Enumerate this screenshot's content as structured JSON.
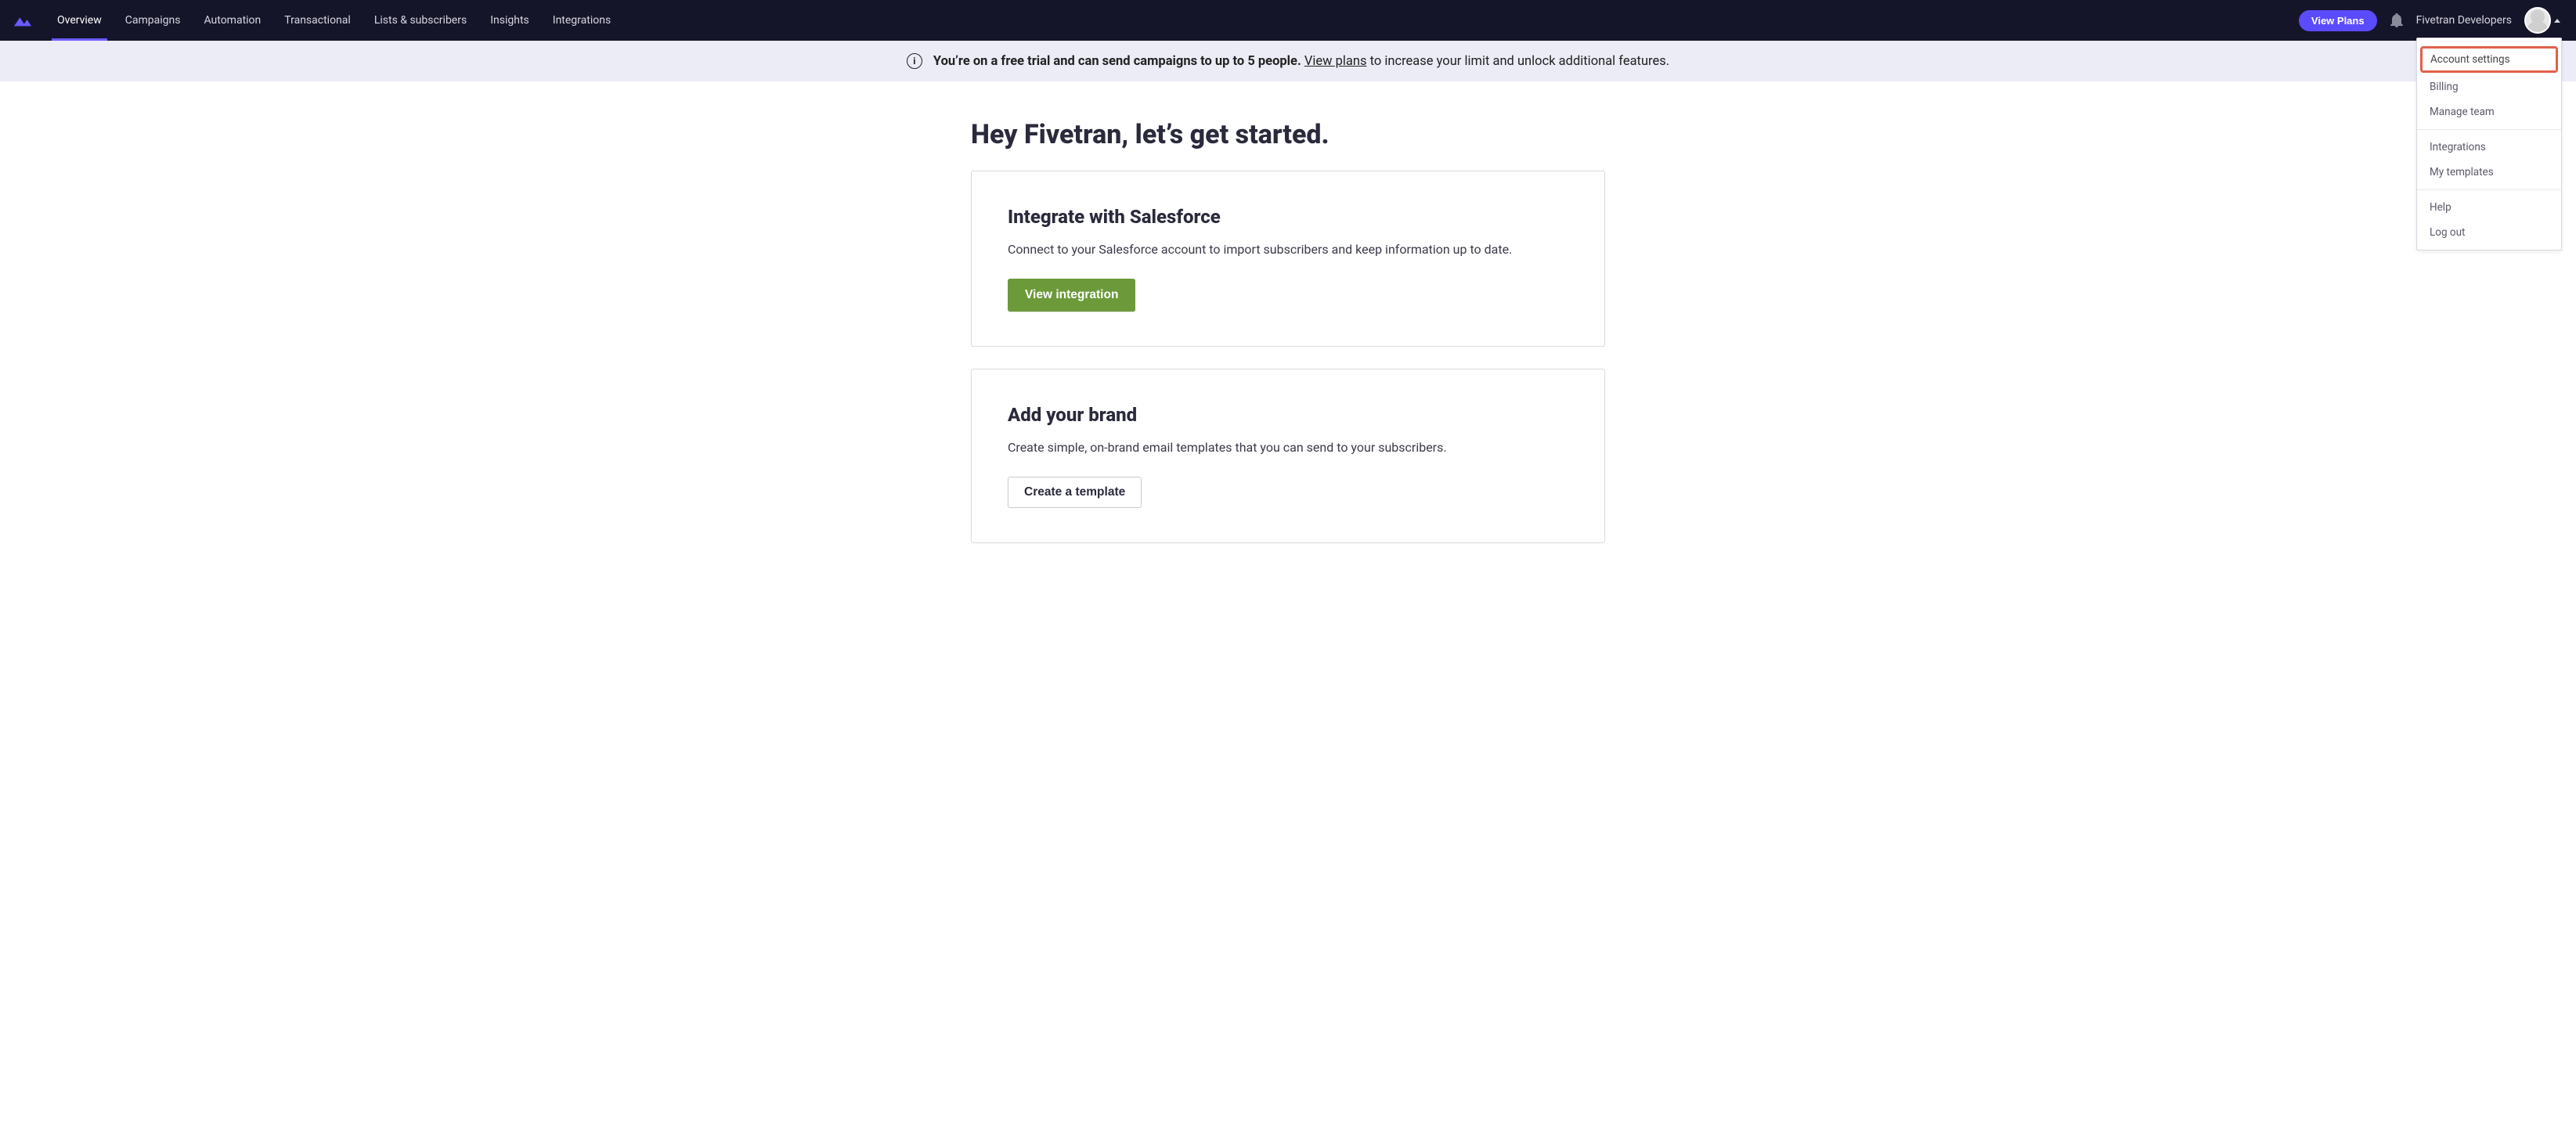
{
  "nav": {
    "items": [
      {
        "label": "Overview",
        "active": true
      },
      {
        "label": "Campaigns"
      },
      {
        "label": "Automation"
      },
      {
        "label": "Transactional"
      },
      {
        "label": "Lists & subscribers"
      },
      {
        "label": "Insights"
      },
      {
        "label": "Integrations"
      }
    ],
    "plans_button": "View Plans",
    "user_label": "Fivetran Developers"
  },
  "banner": {
    "strong": "You’re on a free trial and can send campaigns to up to 5 people.",
    "link": "View plans",
    "rest": " to increase your limit and unlock additional features."
  },
  "greeting": "Hey Fivetran, let’s get started.",
  "cards": {
    "salesforce": {
      "title": "Integrate with Salesforce",
      "desc": "Connect to your Salesforce account to import subscribers and keep information up to date.",
      "cta": "View integration"
    },
    "brand": {
      "title": "Add your brand",
      "desc": "Create simple, on-brand email templates that you can send to your subscribers.",
      "cta": "Create a template"
    }
  },
  "dropdown": {
    "account_settings": "Account settings",
    "billing": "Billing",
    "manage_team": "Manage team",
    "integrations": "Integrations",
    "my_templates": "My templates",
    "help": "Help",
    "log_out": "Log out"
  }
}
